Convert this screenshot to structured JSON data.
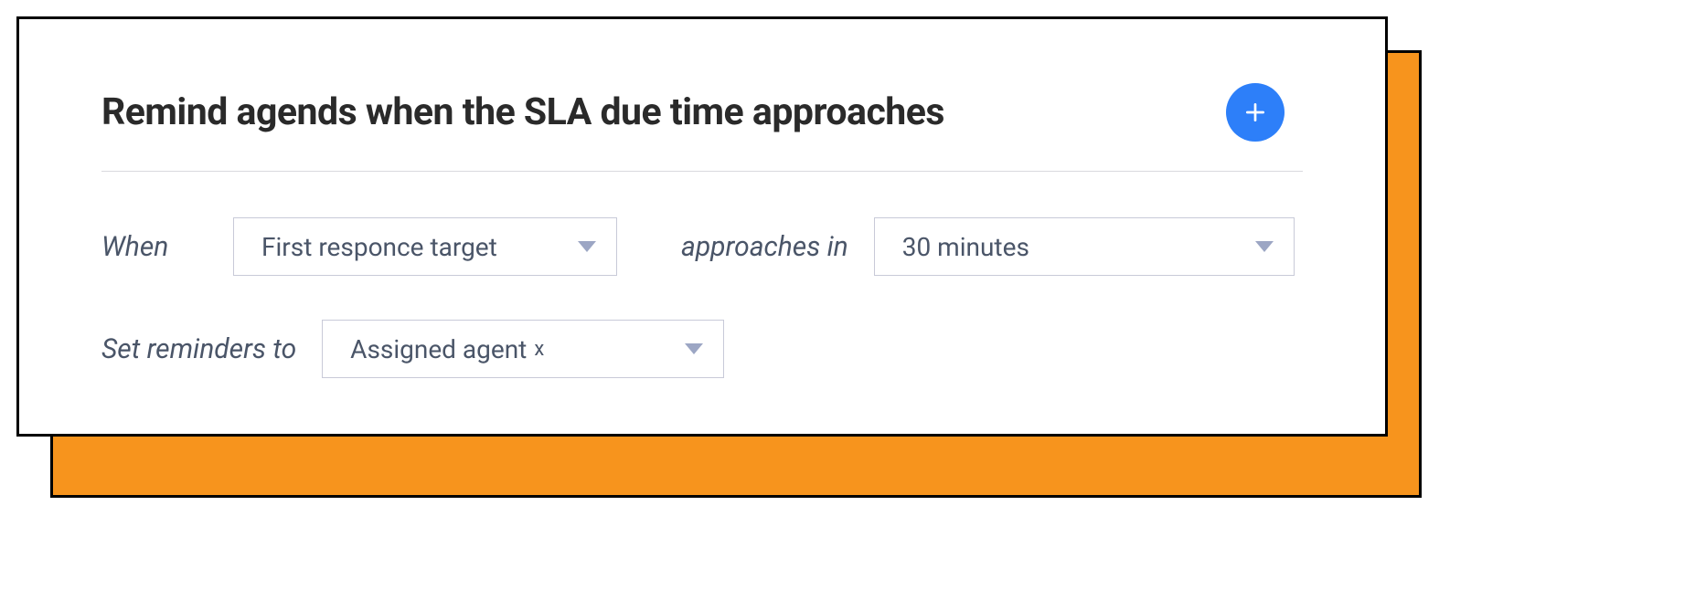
{
  "card": {
    "title": "Remind agends when the SLA due time approaches"
  },
  "labels": {
    "when": "When",
    "approaches_in": "approaches in",
    "set_reminders_to": "Set reminders to"
  },
  "selects": {
    "when_value": "First responce target",
    "duration_value": "30 minutes",
    "reminder_target": "Assigned agent",
    "reminder_remove": "x"
  },
  "icons": {
    "add": "plus-icon"
  }
}
